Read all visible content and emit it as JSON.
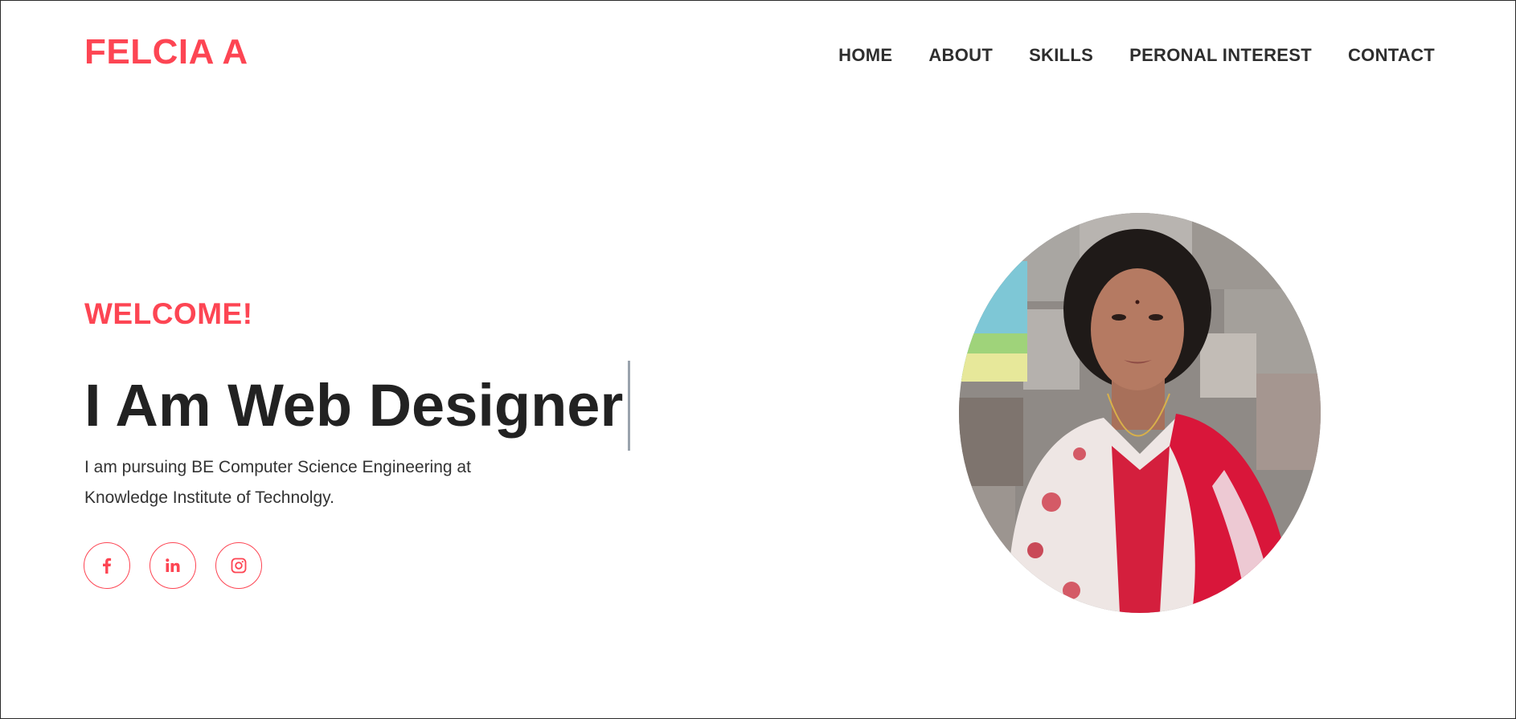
{
  "header": {
    "logo": "FELCIA A",
    "nav": [
      "HOME",
      "ABOUT",
      "SKILLS",
      "PERONAL INTEREST",
      "CONTACT"
    ]
  },
  "hero": {
    "welcome": "WELCOME!",
    "headline": "I Am Web Designer",
    "intro_line1": "I am pursuing BE Computer Science Engineering at",
    "intro_line2": "Knowledge Institute of Technolgy.",
    "socials": [
      "facebook-icon",
      "linkedin-icon",
      "instagram-icon"
    ]
  },
  "colors": {
    "accent": "#fd4553",
    "text_dark": "#222222",
    "nav_text": "#2e2e2e"
  }
}
